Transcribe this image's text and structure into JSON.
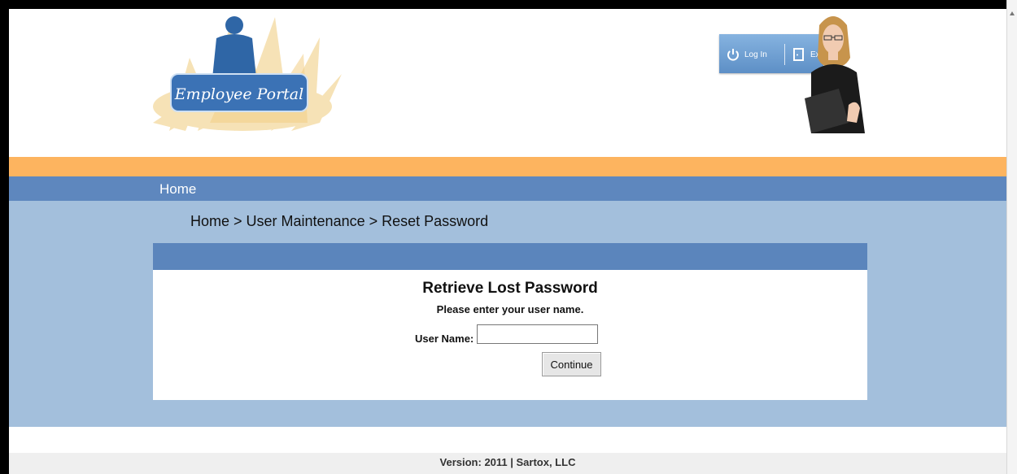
{
  "header": {
    "logo_text": "Employee Portal",
    "nav_buttons": [
      {
        "label": "Log In",
        "icon": "power-icon"
      },
      {
        "label": "Exit",
        "icon": "exit-door-icon"
      }
    ]
  },
  "navbar": {
    "home_label": "Home"
  },
  "breadcrumb": "Home > User Maintenance > Reset Password",
  "form": {
    "title": "Retrieve Lost Password",
    "subtitle": "Please enter your user name.",
    "username_label": "User Name:",
    "username_value": "",
    "continue_label": "Continue"
  },
  "footer": {
    "text": "Version: 2011 | Sartox, LLC"
  },
  "colors": {
    "orange_bar": "#fdb45f",
    "nav_bar": "#5e87be",
    "content_bg": "#a3bfdc",
    "panel_header": "#5b85bc"
  }
}
